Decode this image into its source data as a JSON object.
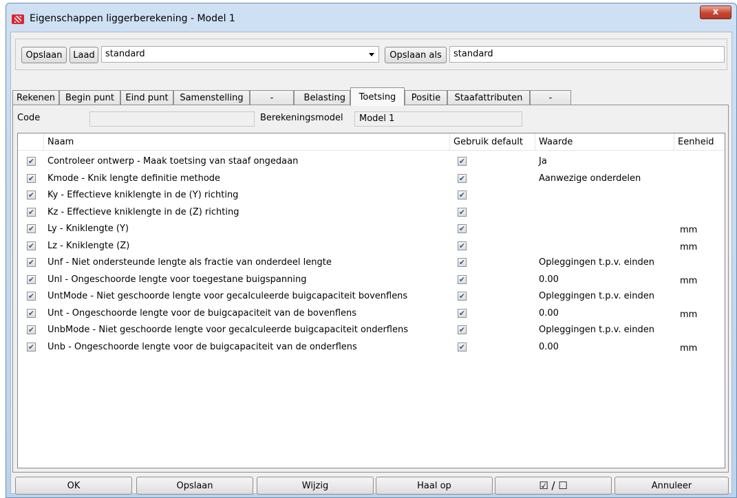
{
  "window": {
    "title": "Eigenschappen liggerberekening - Model 1",
    "close_label": "x"
  },
  "toolbar": {
    "save_label": "Opslaan",
    "load_label": "Laad",
    "preset_value": "standard",
    "save_as_label": "Opslaan als",
    "save_as_value": "standard"
  },
  "tabs": [
    {
      "label": "Rekenen"
    },
    {
      "label": "Begin punt"
    },
    {
      "label": "Eind punt"
    },
    {
      "label": "Samenstelling"
    },
    {
      "label": "-"
    },
    {
      "label": "Belasting"
    },
    {
      "label": "Toetsing",
      "active": true
    },
    {
      "label": "Positie"
    },
    {
      "label": "Staafattributen"
    },
    {
      "label": "-"
    }
  ],
  "panel": {
    "code_label": "Code",
    "code_value": "",
    "model_label": "Berekeningsmodel",
    "model_value": "Model 1"
  },
  "grid": {
    "headers": {
      "name": "Naam",
      "use_default": "Gebruik default",
      "value": "Waarde",
      "unit": "Eenheid"
    },
    "rows": [
      {
        "name": "Controleer ontwerp - Maak toetsing van staaf ongedaan",
        "value": "Ja",
        "unit": ""
      },
      {
        "name": "Kmode - Knik lengte definitie methode",
        "value": "Aanwezige onderdelen",
        "unit": ""
      },
      {
        "name": "Ky - Effectieve kniklengte in de (Y) richting",
        "value": "",
        "unit": ""
      },
      {
        "name": "Kz - Effectieve kniklengte in de (Z) richting",
        "value": "",
        "unit": ""
      },
      {
        "name": "Ly - Kniklengte (Y)",
        "value": "",
        "unit": "mm"
      },
      {
        "name": "Lz - Kniklengte (Z)",
        "value": "",
        "unit": "mm"
      },
      {
        "name": "Unf - Niet ondersteunde lengte als fractie van onderdeel lengte",
        "value": "Opleggingen t.p.v. einden",
        "unit": ""
      },
      {
        "name": "Unl - Ongeschoorde lengte voor toegestane buigspanning",
        "value": "0.00",
        "unit": "mm"
      },
      {
        "name": "UntMode - Niet geschoorde lengte voor gecalculeerde buigcapaciteit bovenflens",
        "value": "Opleggingen t.p.v. einden",
        "unit": ""
      },
      {
        "name": "Unt - Ongeschoorde lengte voor de buigcapaciteit van de bovenflens",
        "value": "0.00",
        "unit": "mm"
      },
      {
        "name": "UnbMode - Niet geschoorde lengte voor gecalculeerde buigcapaciteit onderflens",
        "value": "Opleggingen t.p.v. einden",
        "unit": ""
      },
      {
        "name": "Unb - Ongeschoorde lengte voor de buigcapaciteit van de onderflens",
        "value": "0.00",
        "unit": "mm"
      }
    ]
  },
  "buttons": {
    "ok": "OK",
    "save": "Opslaan",
    "modify": "Wijzig",
    "get": "Haal op",
    "toggle": "☑ / ☐",
    "cancel": "Annuleer"
  }
}
